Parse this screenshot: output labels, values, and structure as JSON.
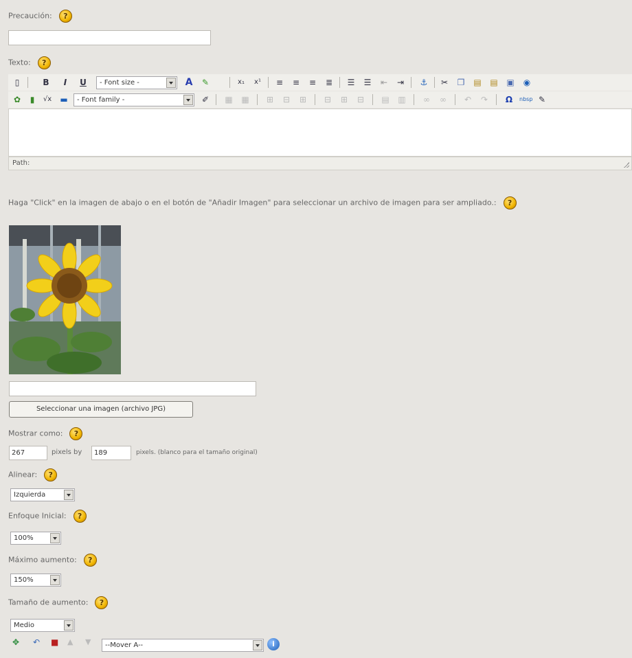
{
  "labels": {
    "precaucion": "Precaución:",
    "texto": "Texto:",
    "image_instructions": "Haga \"Click\" en la imagen de abajo o en el botón de \"Añadir Imagen\" para seleccionar un archivo de imagen para ser ampliado.:",
    "mostrar_como": "Mostrar como:",
    "pixels_by": "pixels by",
    "pixels_note": "pixels. (blanco para el tamaño original)",
    "alinear": "Alinear:",
    "enfoque_inicial": "Enfoque Inicial:",
    "maximo_aumento": "Máximo aumento:",
    "tamano_aumento": "Tamaño de aumento:"
  },
  "help_glyph": "?",
  "inputs": {
    "precaucion_value": "",
    "image_path_value": "",
    "width_value": "267",
    "height_value": "189"
  },
  "editor": {
    "font_size_placeholder": "- Font size -",
    "font_family_placeholder": "- Font family -",
    "path_label": "Path:",
    "toolbar_icons_row1": [
      "new-document-icon",
      "bold-icon",
      "italic-icon",
      "underline-icon",
      "font-size-select",
      "text-color-icon",
      "highlight-color-icon",
      "subscript-icon",
      "superscript-icon",
      "align-left-icon",
      "align-center-icon",
      "align-right-icon",
      "align-justify-icon",
      "bullet-list-icon",
      "numbered-list-icon",
      "outdent-icon",
      "indent-icon",
      "anchor-icon",
      "cut-icon",
      "copy-icon",
      "paste-icon",
      "paste-text-icon",
      "paste-word-icon",
      "help-icon"
    ],
    "toolbar_icons_row2": [
      "image-icon",
      "media-icon",
      "math-icon",
      "horizontal-rule-icon",
      "font-family-select",
      "edit-icon",
      "table-icon",
      "cell-props-icon",
      "insert-row-icon",
      "delete-row-icon",
      "insert-col-icon",
      "delete-col-icon",
      "merge-cells-icon",
      "split-cells-icon",
      "undo-icon",
      "redo-icon",
      "special-char-icon",
      "nonbreaking-icon",
      "cleanup-icon"
    ],
    "glyphs": {
      "bold": "B",
      "italic": "I",
      "underline": "U",
      "text_color": "A",
      "special_char": "Ω",
      "anchor": "⚓",
      "cut": "✂"
    }
  },
  "button": {
    "select_image": "Seleccionar una imagen (archivo JPG)"
  },
  "selects": {
    "alinear": "Izquierda",
    "enfoque": "100%",
    "maximo": "150%",
    "tamano": "Medio",
    "mover": "--Mover A--"
  },
  "image": {
    "alt": "sunflower"
  },
  "bottom_icons": [
    "move-icon",
    "undo-icon",
    "delete-icon",
    "up-arrow-icon",
    "down-arrow-icon",
    "info-icon"
  ],
  "colors": {
    "background": "#e7e5e1",
    "help_icon": "#f0b400"
  }
}
